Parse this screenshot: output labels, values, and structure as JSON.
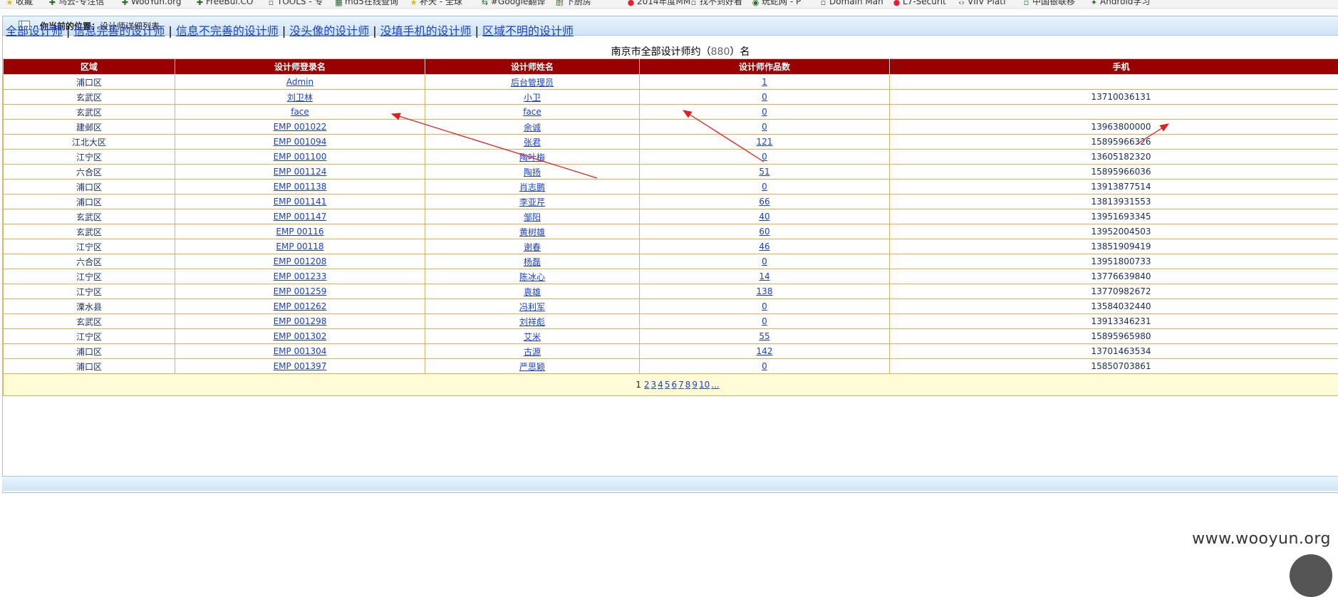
{
  "bookmarks": [
    {
      "label": "收藏",
      "icon": "star-icon"
    },
    {
      "label": "乌云-专注信",
      "icon": "bookmark-icon"
    },
    {
      "label": "WooYun.org",
      "icon": "bookmark-icon"
    },
    {
      "label": "FreeBuf.CO",
      "icon": "bookmark-icon"
    },
    {
      "label": "TOOLS - 专",
      "icon": "page-icon"
    },
    {
      "label": "md5在线查询",
      "icon": "grid-icon"
    },
    {
      "label": "补天 - 全球",
      "icon": "star-icon"
    },
    {
      "label": "#Google翻译",
      "icon": "translate-icon"
    },
    {
      "label": "下厨房",
      "icon": "kitchen-icon"
    },
    {
      "label": "2014年度MM",
      "icon": "circle-icon"
    },
    {
      "label": "找不到好看",
      "icon": "page-icon"
    },
    {
      "label": "玩蛇网 - P",
      "icon": "python-icon"
    },
    {
      "label": "Domain Man",
      "icon": "page-icon"
    },
    {
      "label": "L7-Securit",
      "icon": "circle-icon"
    },
    {
      "label": "VIIV Platf",
      "icon": "code-icon"
    },
    {
      "label": "中国银联移",
      "icon": "page-icon"
    },
    {
      "label": "Android学习",
      "icon": "android-icon"
    }
  ],
  "header": {
    "location_label": "你当前的位置：",
    "location_value": "设计师详细列表"
  },
  "nav": [
    {
      "label": "全部设计师"
    },
    {
      "label": "信息完善的设计师"
    },
    {
      "label": "信息不完善的设计师"
    },
    {
      "label": "没头像的设计师"
    },
    {
      "label": "没填手机的设计师"
    },
    {
      "label": "区域不明的设计师"
    }
  ],
  "nav_separator": "|",
  "caption": {
    "prefix": "南京市全部设计师约（",
    "count": "880",
    "suffix": "）名"
  },
  "table": {
    "headers": [
      "区域",
      "设计师登录名",
      "设计师姓名",
      "设计师作品数",
      "手机"
    ],
    "rows": [
      {
        "area": "浦口区",
        "login": "Admin",
        "name": "后台管理员",
        "works": "1",
        "phone": ""
      },
      {
        "area": "玄武区",
        "login": "刘卫林",
        "name": "小卫",
        "works": "0",
        "phone": "13710036131"
      },
      {
        "area": "玄武区",
        "login": "face",
        "name": "face",
        "works": "0",
        "phone": ""
      },
      {
        "area": "建邺区",
        "login": "EMP 001022",
        "name": "余诚",
        "works": "0",
        "phone": "13963800000"
      },
      {
        "area": "江北大区",
        "login": "EMP 001094",
        "name": "张君",
        "works": "121",
        "phone": "15895966326"
      },
      {
        "area": "江宁区",
        "login": "EMP 001100",
        "name": "陶叶梅",
        "works": "0",
        "phone": "13605182320"
      },
      {
        "area": "六合区",
        "login": "EMP 001124",
        "name": "陶扬",
        "works": "51",
        "phone": "15895966036"
      },
      {
        "area": "浦口区",
        "login": "EMP 001138",
        "name": "肖志鹏",
        "works": "0",
        "phone": "13913877514"
      },
      {
        "area": "浦口区",
        "login": "EMP 001141",
        "name": "李亚芹",
        "works": "66",
        "phone": "13813931553"
      },
      {
        "area": "玄武区",
        "login": "EMP 001147",
        "name": "邹阳",
        "works": "40",
        "phone": "13951693345"
      },
      {
        "area": "玄武区",
        "login": "EMP 00116",
        "name": "黄树雄",
        "works": "60",
        "phone": "13952004503"
      },
      {
        "area": "江宁区",
        "login": "EMP 00118",
        "name": "谢春",
        "works": "46",
        "phone": "13851909419"
      },
      {
        "area": "六合区",
        "login": "EMP 001208",
        "name": "杨磊",
        "works": "0",
        "phone": "13951800733"
      },
      {
        "area": "江宁区",
        "login": "EMP 001233",
        "name": "陈冰心",
        "works": "14",
        "phone": "13776639840"
      },
      {
        "area": "江宁区",
        "login": "EMP 001259",
        "name": "袁雄",
        "works": "138",
        "phone": "13770982672"
      },
      {
        "area": "溧水县",
        "login": "EMP 001262",
        "name": "冯利军",
        "works": "0",
        "phone": "13584032440"
      },
      {
        "area": "玄武区",
        "login": "EMP 001298",
        "name": "刘祥彪",
        "works": "0",
        "phone": "13913346231"
      },
      {
        "area": "江宁区",
        "login": "EMP 001302",
        "name": "艾米",
        "works": "55",
        "phone": "15895965980"
      },
      {
        "area": "浦口区",
        "login": "EMP 001304",
        "name": "古源",
        "works": "142",
        "phone": "13701463534"
      },
      {
        "area": "浦口区",
        "login": "EMP 001397",
        "name": "严思颖",
        "works": "0",
        "phone": "15850703861"
      }
    ]
  },
  "pager": {
    "current": "1",
    "pages": [
      "2",
      "3",
      "4",
      "5",
      "6",
      "7",
      "8",
      "9",
      "10"
    ],
    "more": "..."
  },
  "watermark": "www.wooyun.org",
  "colors": {
    "header_bg": "#990000",
    "link": "#1a3fd6",
    "arrow": "#e02020",
    "pager_bg": "#fffcd6"
  }
}
